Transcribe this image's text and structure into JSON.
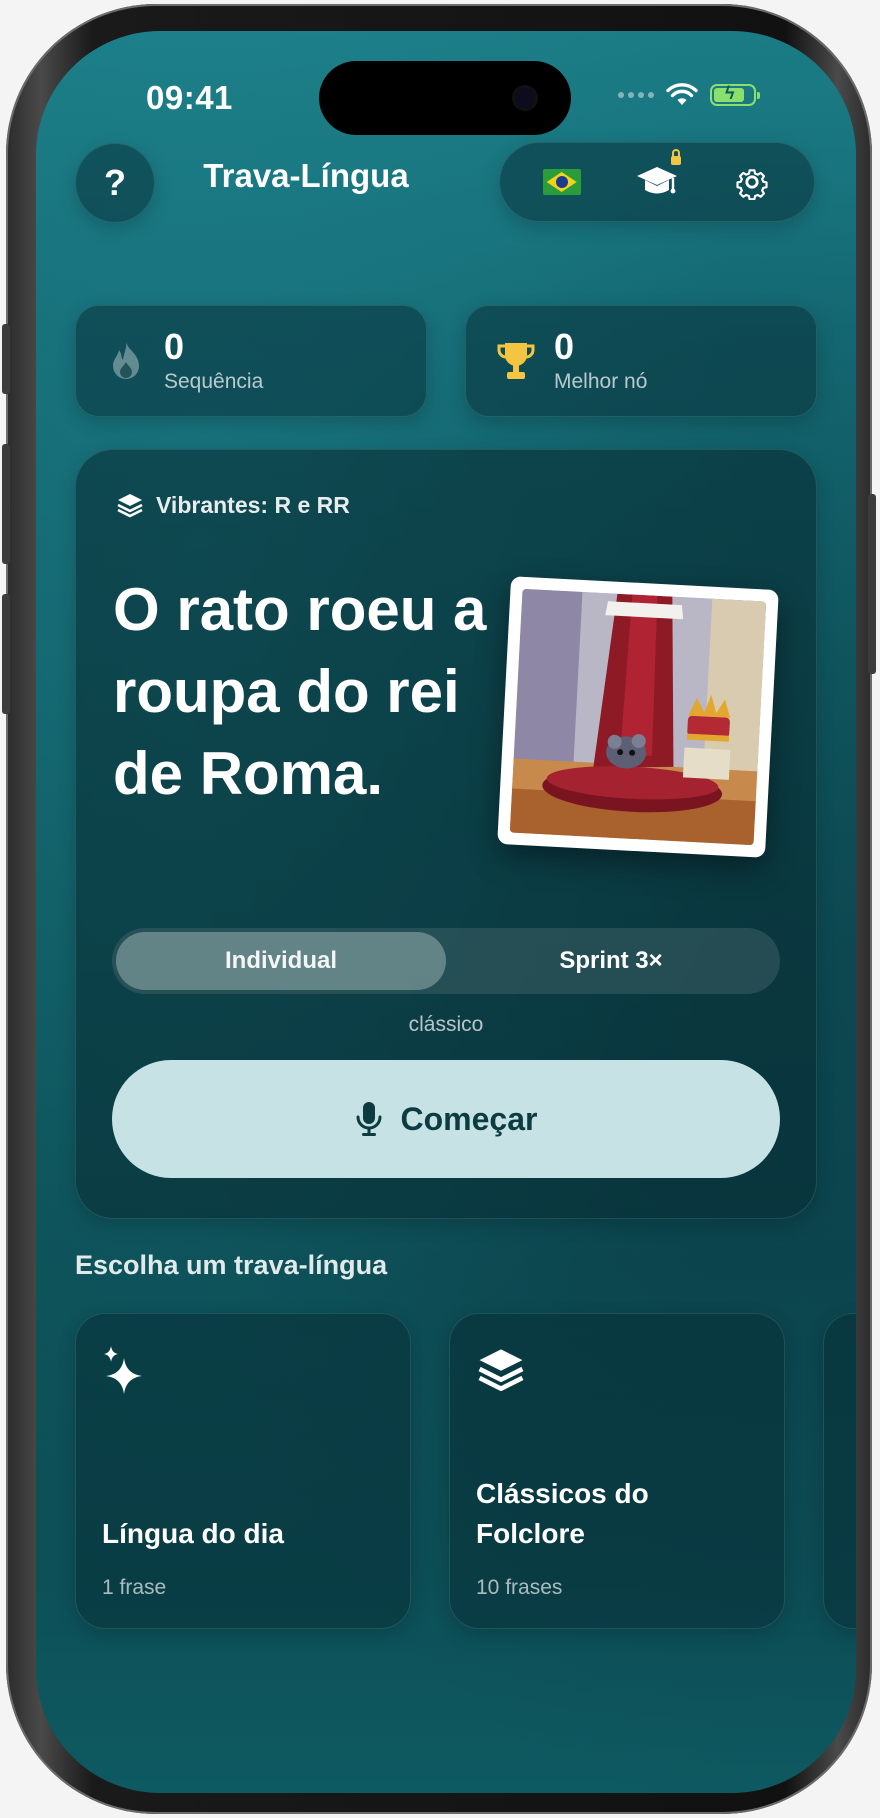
{
  "status_bar": {
    "time": "09:41"
  },
  "header": {
    "help_label": "?",
    "title": "Trava-Língua",
    "toolbar": [
      {
        "icon": "brazil-flag-icon"
      },
      {
        "icon": "graduation-cap-icon",
        "locked": true
      },
      {
        "icon": "gear-icon"
      }
    ]
  },
  "stats": {
    "streak": {
      "value": "0",
      "label": "Sequência",
      "icon": "flame-icon"
    },
    "best": {
      "value": "0",
      "label": "Melhor nó",
      "icon": "trophy-icon"
    }
  },
  "featured": {
    "tag": "Vibrantes: R e RR",
    "phrase": "O rato roeu a roupa do rei de Roma.",
    "image": "illustration of a rat on a red cushion with royal robe and crown",
    "modes": [
      "Individual",
      "Sprint 3×"
    ],
    "selected_mode": "Individual",
    "mode_caption": "clássico",
    "start_label": "Começar"
  },
  "collection": {
    "title": "Escolha um trava-língua",
    "tiles": [
      {
        "title": "Língua do dia",
        "subtitle": "1 frase",
        "icon": "sparkles-icon"
      },
      {
        "title": "Clássicos do Folclore",
        "subtitle": "10 frases",
        "icon": "layers-icon"
      }
    ]
  },
  "colors": {
    "accent_button": "#c6e2e4",
    "background_top": "#1b7c86",
    "background_bottom": "#0c4d55",
    "battery": "#8be06b",
    "trophy": "#f5c542"
  }
}
